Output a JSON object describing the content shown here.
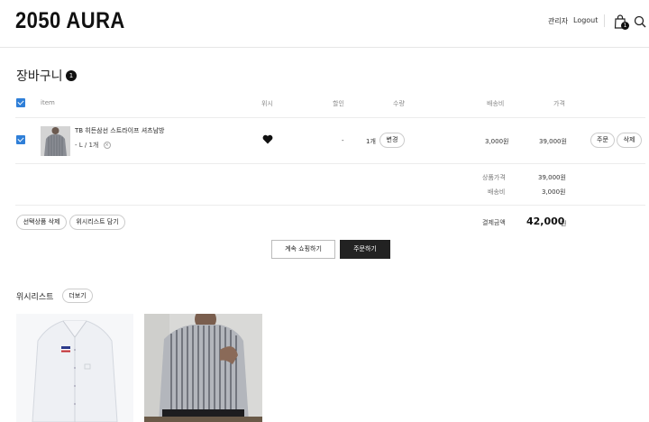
{
  "header": {
    "logo": "2050 AURA",
    "admin_link": "관리자",
    "logout_link": "Logout",
    "cart_badge": "1",
    "icons": [
      "shopping-bag-icon",
      "search-icon"
    ]
  },
  "cart": {
    "title": "장바구니",
    "count": "1",
    "columns": {
      "item": "item",
      "wish": "위시",
      "discount": "할인",
      "quantity": "수량",
      "shipping": "배송비",
      "price": "가격"
    },
    "rows": [
      {
        "name": "TB 히든삼선 스트라이프 셔츠남방",
        "option": "- L / 1개",
        "discount": "-",
        "quantity": "1개",
        "change_label": "변경",
        "shipping": "3,000원",
        "price": "39,000원",
        "order_label": "주문",
        "delete_label": "삭제",
        "wish_icon": "heart-icon"
      }
    ],
    "summary": {
      "product_price_label": "상품가격",
      "product_price": "39,000원",
      "shipping_label": "배송비",
      "shipping": "3,000원",
      "total_label": "결제금액",
      "total": "42,000",
      "total_unit": "원"
    },
    "actions": {
      "delete_selected": "선택상품 삭제",
      "move_to_wishlist": "위시리스트 담기",
      "continue_shopping": "계속 쇼핑하기",
      "checkout": "주문하기"
    }
  },
  "wishlist": {
    "title": "위시리스트",
    "more_label": "더보기"
  },
  "colors": {
    "accent_checkbox": "#2f7fd8",
    "dark_button": "#222222"
  }
}
